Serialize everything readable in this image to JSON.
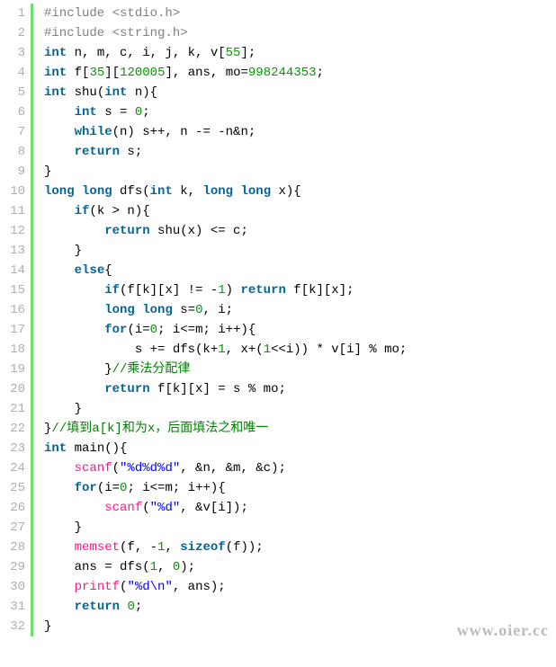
{
  "watermark": "www.oier.cc",
  "line_count": 32,
  "code_lines": [
    [
      {
        "cls": "pp",
        "t": "#include <stdio.h>"
      }
    ],
    [
      {
        "cls": "pp",
        "t": "#include <string.h>"
      }
    ],
    [
      {
        "cls": "kw",
        "t": "int"
      },
      {
        "t": " n, m, c, i, j, k, v["
      },
      {
        "cls": "num",
        "t": "55"
      },
      {
        "t": "];"
      }
    ],
    [
      {
        "cls": "kw",
        "t": "int"
      },
      {
        "t": " f["
      },
      {
        "cls": "num",
        "t": "35"
      },
      {
        "t": "]["
      },
      {
        "cls": "num",
        "t": "120005"
      },
      {
        "t": "], ans, mo="
      },
      {
        "cls": "num",
        "t": "998244353"
      },
      {
        "t": ";"
      }
    ],
    [
      {
        "cls": "kw",
        "t": "int"
      },
      {
        "t": " shu("
      },
      {
        "cls": "kw",
        "t": "int"
      },
      {
        "t": " n){"
      }
    ],
    [
      {
        "t": "    "
      },
      {
        "cls": "kw",
        "t": "int"
      },
      {
        "t": " s = "
      },
      {
        "cls": "num",
        "t": "0"
      },
      {
        "t": ";"
      }
    ],
    [
      {
        "t": "    "
      },
      {
        "cls": "kw",
        "t": "while"
      },
      {
        "t": "(n) s++, n -= -n&n;"
      }
    ],
    [
      {
        "t": "    "
      },
      {
        "cls": "kw",
        "t": "return"
      },
      {
        "t": " s;"
      }
    ],
    [
      {
        "t": "}"
      }
    ],
    [
      {
        "cls": "kw",
        "t": "long"
      },
      {
        "t": " "
      },
      {
        "cls": "kw",
        "t": "long"
      },
      {
        "t": " dfs("
      },
      {
        "cls": "kw",
        "t": "int"
      },
      {
        "t": " k, "
      },
      {
        "cls": "kw",
        "t": "long"
      },
      {
        "t": " "
      },
      {
        "cls": "kw",
        "t": "long"
      },
      {
        "t": " x){"
      }
    ],
    [
      {
        "t": "    "
      },
      {
        "cls": "kw",
        "t": "if"
      },
      {
        "t": "(k > n){"
      }
    ],
    [
      {
        "t": "        "
      },
      {
        "cls": "kw",
        "t": "return"
      },
      {
        "t": " shu(x) <= c;"
      }
    ],
    [
      {
        "t": "    }"
      }
    ],
    [
      {
        "t": "    "
      },
      {
        "cls": "kw",
        "t": "else"
      },
      {
        "t": "{"
      }
    ],
    [
      {
        "t": "        "
      },
      {
        "cls": "kw",
        "t": "if"
      },
      {
        "t": "(f[k][x] != -"
      },
      {
        "cls": "num",
        "t": "1"
      },
      {
        "t": ") "
      },
      {
        "cls": "kw",
        "t": "return"
      },
      {
        "t": " f[k][x];"
      }
    ],
    [
      {
        "t": "        "
      },
      {
        "cls": "kw",
        "t": "long"
      },
      {
        "t": " "
      },
      {
        "cls": "kw",
        "t": "long"
      },
      {
        "t": " s="
      },
      {
        "cls": "num",
        "t": "0"
      },
      {
        "t": ", i;"
      }
    ],
    [
      {
        "t": "        "
      },
      {
        "cls": "kw",
        "t": "for"
      },
      {
        "t": "(i="
      },
      {
        "cls": "num",
        "t": "0"
      },
      {
        "t": "; i<=m; i++){"
      }
    ],
    [
      {
        "t": "            s += dfs(k+"
      },
      {
        "cls": "num",
        "t": "1"
      },
      {
        "t": ", x+("
      },
      {
        "cls": "num",
        "t": "1"
      },
      {
        "t": "<<i)) * v[i] % mo;"
      }
    ],
    [
      {
        "t": "        }"
      },
      {
        "cls": "cmt",
        "t": "//乘法分配律"
      }
    ],
    [
      {
        "t": "        "
      },
      {
        "cls": "kw",
        "t": "return"
      },
      {
        "t": " f[k][x] = s % mo;"
      }
    ],
    [
      {
        "t": "    }"
      }
    ],
    [
      {
        "t": "}"
      },
      {
        "cls": "cmt",
        "t": "//填到a[k]和为x，后面填法之和唯一"
      }
    ],
    [
      {
        "cls": "kw",
        "t": "int"
      },
      {
        "t": " main(){"
      }
    ],
    [
      {
        "t": "    "
      },
      {
        "cls": "fn",
        "t": "scanf"
      },
      {
        "t": "("
      },
      {
        "cls": "str",
        "t": "\"%d%d%d\""
      },
      {
        "t": ", &n, &m, &c);"
      }
    ],
    [
      {
        "t": "    "
      },
      {
        "cls": "kw",
        "t": "for"
      },
      {
        "t": "(i="
      },
      {
        "cls": "num",
        "t": "0"
      },
      {
        "t": "; i<=m; i++){"
      }
    ],
    [
      {
        "t": "        "
      },
      {
        "cls": "fn",
        "t": "scanf"
      },
      {
        "t": "("
      },
      {
        "cls": "str",
        "t": "\"%d\""
      },
      {
        "t": ", &v[i]);"
      }
    ],
    [
      {
        "t": "    }"
      }
    ],
    [
      {
        "t": "    "
      },
      {
        "cls": "fn",
        "t": "memset"
      },
      {
        "t": "(f, -"
      },
      {
        "cls": "num",
        "t": "1"
      },
      {
        "t": ", "
      },
      {
        "cls": "kw",
        "t": "sizeof"
      },
      {
        "t": "(f));"
      }
    ],
    [
      {
        "t": "    ans = dfs("
      },
      {
        "cls": "num",
        "t": "1"
      },
      {
        "t": ", "
      },
      {
        "cls": "num",
        "t": "0"
      },
      {
        "t": ");"
      }
    ],
    [
      {
        "t": "    "
      },
      {
        "cls": "fn",
        "t": "printf"
      },
      {
        "t": "("
      },
      {
        "cls": "str",
        "t": "\"%d\\n\""
      },
      {
        "t": ", ans);"
      }
    ],
    [
      {
        "t": "    "
      },
      {
        "cls": "kw",
        "t": "return"
      },
      {
        "t": " "
      },
      {
        "cls": "num",
        "t": "0"
      },
      {
        "t": ";"
      }
    ],
    [
      {
        "t": "}"
      }
    ]
  ]
}
